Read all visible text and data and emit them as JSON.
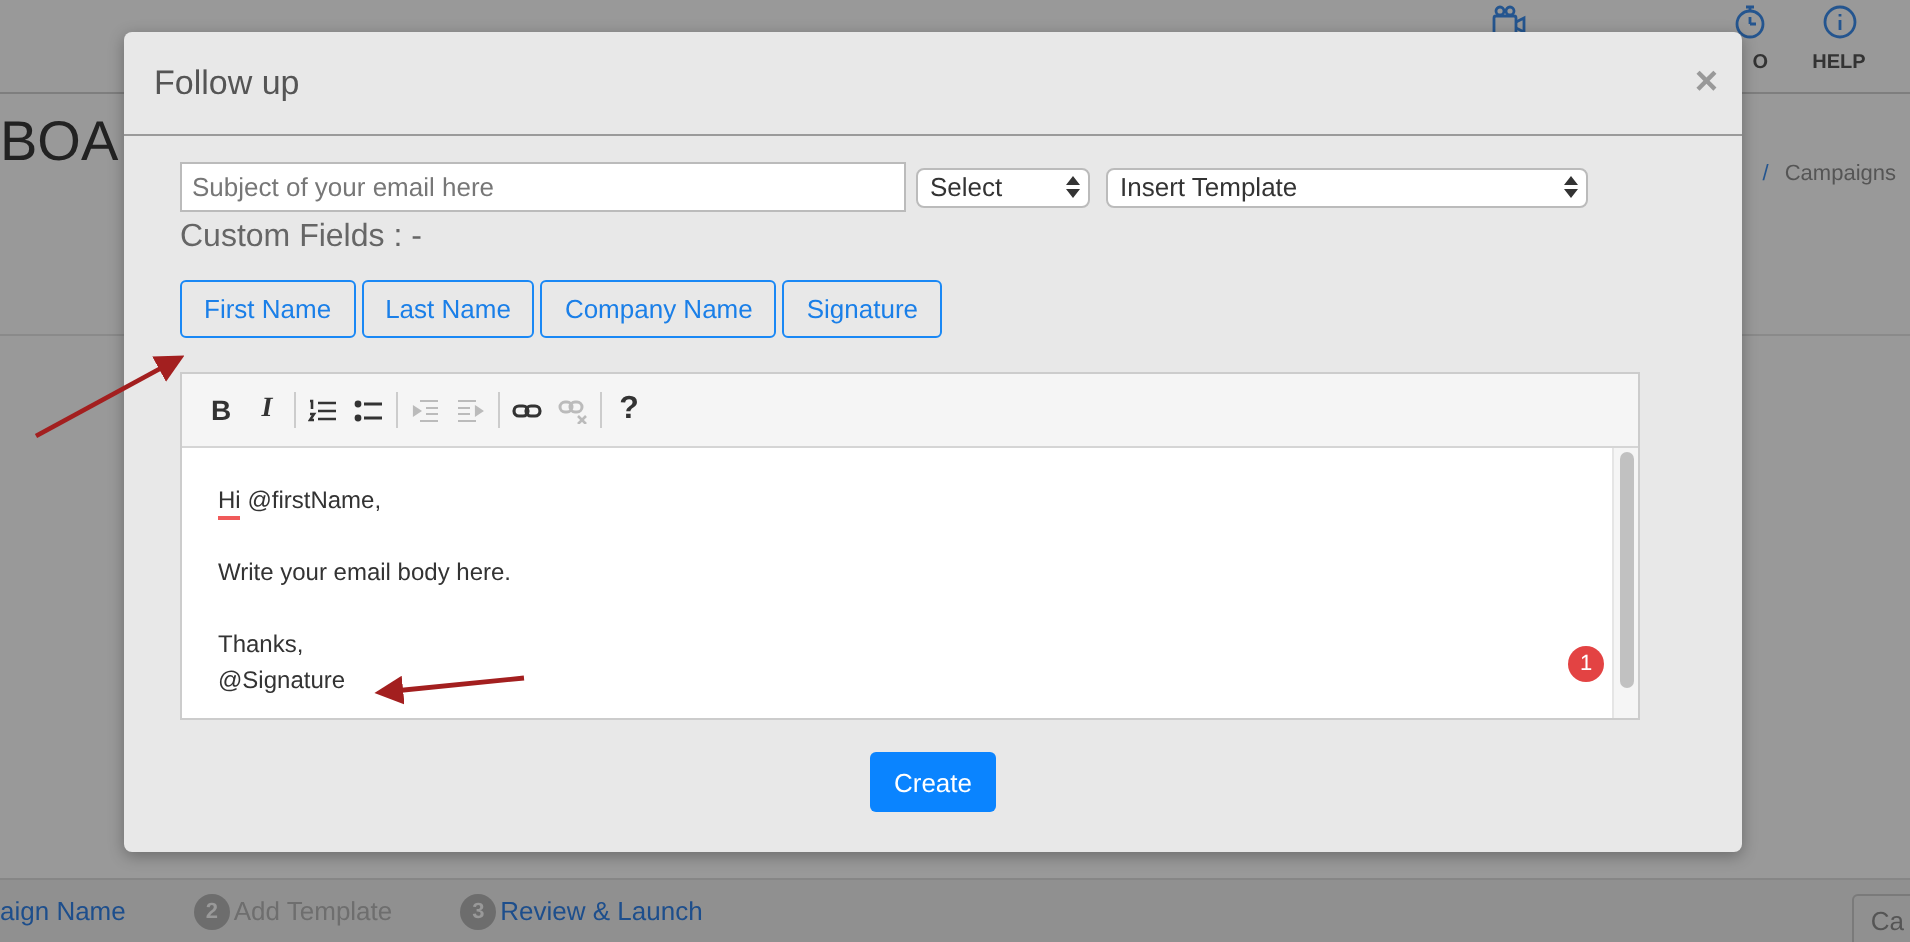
{
  "header": {
    "nav": [
      {
        "kind": "video"
      },
      {
        "kind": "timer",
        "label": "O"
      },
      {
        "kind": "info",
        "label": "HELP"
      }
    ]
  },
  "page": {
    "title": "BOA",
    "breadcrumb": [
      {
        "kind": "separator",
        "text": "/"
      },
      {
        "kind": "link",
        "text": "Campaigns"
      }
    ]
  },
  "steps": [
    {
      "label": "aign Name",
      "active": true
    },
    {
      "number": "2",
      "label": "Add Template",
      "active": false
    },
    {
      "number": "3",
      "label": "Review & Launch",
      "active": true
    }
  ],
  "side_button": "Ca",
  "modal": {
    "title": "Follow up",
    "close": "×",
    "subject": {
      "placeholder": "Subject of your email here"
    },
    "selects": [
      {
        "value": "Select"
      },
      {
        "value": "Insert Template"
      }
    ],
    "custom_fields_label": "Custom Fields : -",
    "custom_fields": [
      "First Name",
      "Last Name",
      "Company Name",
      "Signature"
    ],
    "toolbar": [
      [
        {
          "kind": "bold",
          "label": "B",
          "disabled": false
        },
        {
          "kind": "italic",
          "label": "I",
          "disabled": false
        }
      ],
      [
        {
          "kind": "numbered",
          "disabled": false
        },
        {
          "kind": "bulleted",
          "disabled": false
        }
      ],
      [
        {
          "kind": "outdent",
          "disabled": true
        },
        {
          "kind": "indent",
          "disabled": true
        }
      ],
      [
        {
          "kind": "link",
          "disabled": false
        },
        {
          "kind": "unlink",
          "disabled": true
        }
      ],
      [
        {
          "kind": "help",
          "label": "?",
          "disabled": false
        }
      ]
    ],
    "body": [
      {
        "lines": [
          {
            "words": [
              {
                "text": "Hi",
                "misspelled": true
              },
              {
                "text": "@firstName,",
                "misspelled": false
              }
            ]
          }
        ]
      },
      {
        "lines": [
          {
            "words": [
              {
                "text": "Write your email body here.",
                "misspelled": false
              }
            ]
          }
        ]
      },
      {
        "lines": [
          {
            "words": [
              {
                "text": "Thanks,",
                "misspelled": false
              }
            ]
          },
          {
            "words": [
              {
                "text": "@Signature",
                "misspelled": false
              }
            ]
          }
        ]
      }
    ],
    "badge": "1",
    "create": "Create"
  }
}
